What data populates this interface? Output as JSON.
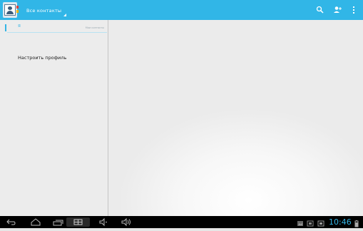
{
  "action_bar": {
    "account_label": "Все контакты",
    "background": "#31b6e7",
    "icons": [
      "contacts-app-icon",
      "search-icon",
      "add-contact-icon",
      "overflow-menu-icon"
    ]
  },
  "left_pane": {
    "search_query": "Я",
    "search_hint": "Мои контакты",
    "profile_item": "Настроить профиль"
  },
  "system_bar": {
    "time": "10:46",
    "nav_icons": [
      "back-icon",
      "home-icon",
      "recent-apps-icon",
      "screenshot-icon",
      "volume-down-icon",
      "volume-up-icon"
    ],
    "status_icons": [
      "gallery-notification-icon",
      "picture-notification-icon",
      "sd-card-icon",
      "battery-icon"
    ],
    "accent": "#33b5e5"
  }
}
